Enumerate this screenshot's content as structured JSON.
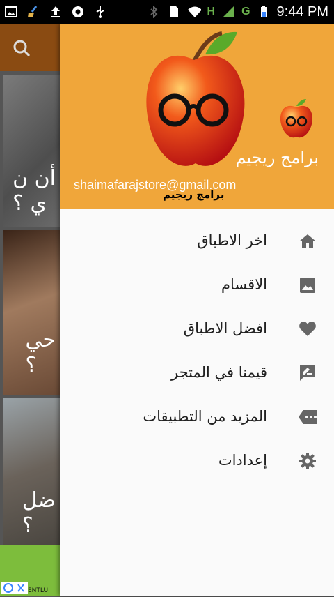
{
  "status_bar": {
    "time": "9:44 PM",
    "network": "H",
    "network2": "G",
    "icons": [
      "image-icon",
      "broom-icon",
      "upload-icon",
      "chrome-icon",
      "usb-icon",
      "bluetooth-icon",
      "sim-icon",
      "wifi-icon",
      "signal-icon",
      "battery-icon"
    ]
  },
  "drawer": {
    "header": {
      "app_name": "برامج ريجيم",
      "email": "shaimafarajstore@gmail.com",
      "logo_caption": "برامج ريجيم",
      "bg_color": "#f0a63a"
    },
    "menu": [
      {
        "label": "اخر الاطباق",
        "icon": "home-icon"
      },
      {
        "label": "الاقسام",
        "icon": "image-icon"
      },
      {
        "label": "افضل الاطباق",
        "icon": "heart-icon"
      },
      {
        "label": "قيمنا في المتجر",
        "icon": "rate-review-icon"
      },
      {
        "label": "المزيد من التطبيقات",
        "icon": "more-apps-icon"
      },
      {
        "label": "إعدادات",
        "icon": "settings-icon"
      }
    ]
  },
  "background": {
    "toolbar_color": "#8a4b12",
    "cards": [
      {
        "text": "أن ن\nي ؟"
      },
      {
        "text": "حي\n؟"
      },
      {
        "text": "ضل\n؟"
      }
    ],
    "ad_text": "ENTLU"
  }
}
